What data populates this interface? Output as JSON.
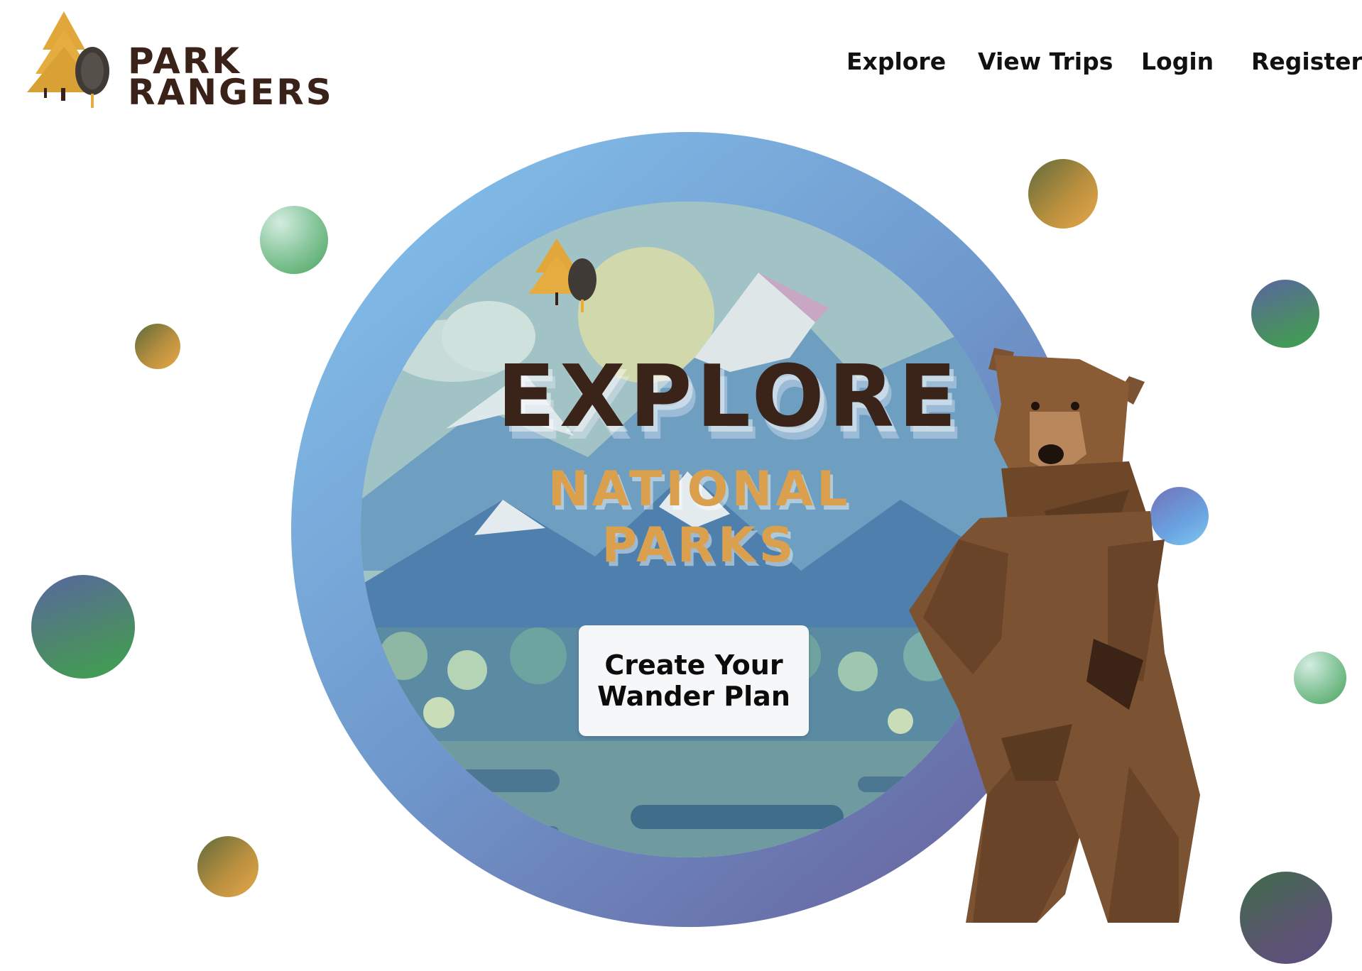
{
  "brand": {
    "line1": "PARK",
    "line2": "RANGERS"
  },
  "nav": {
    "items": [
      "Explore",
      "View Trips",
      "Login",
      "Register"
    ]
  },
  "hero": {
    "title": "EXPLORE",
    "subtitle": "NATIONAL PARKS",
    "cta_label": "Create Your Wander Plan"
  },
  "colors": {
    "brown": "#3a2419",
    "gold": "#dba04d",
    "ring_blue": "#86c5ef",
    "ring_purple": "#675c98",
    "bear_brown": "#7b5232"
  },
  "icons": [
    "pine-tree-icon",
    "oak-tree-icon",
    "bear-illustration"
  ]
}
